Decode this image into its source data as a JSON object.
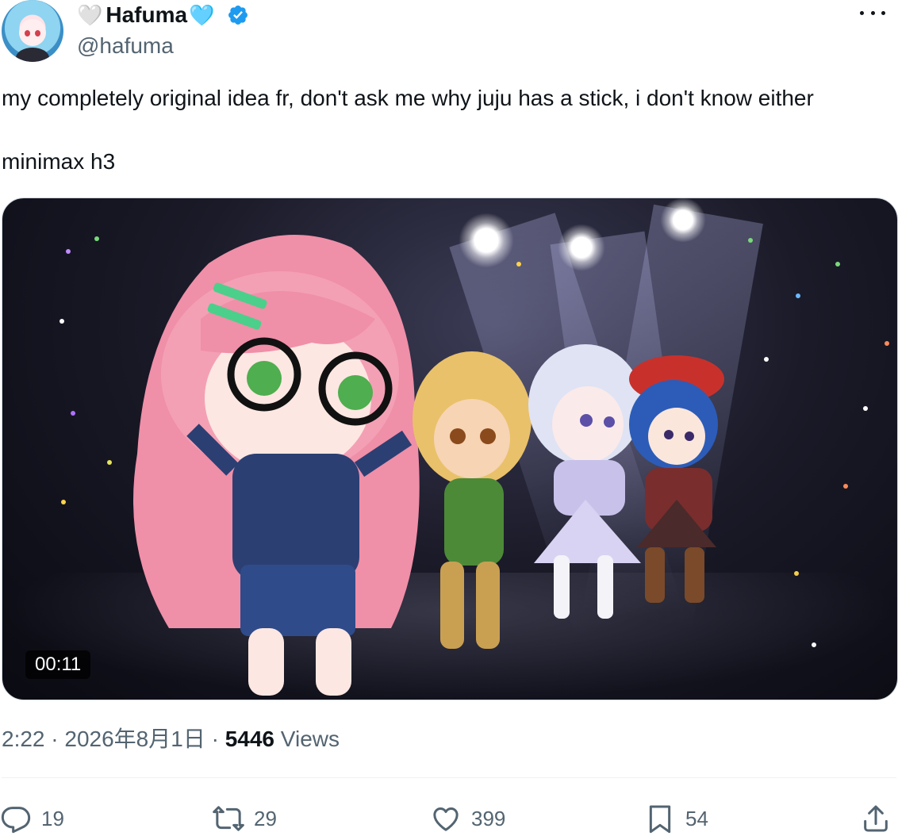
{
  "author": {
    "emoji_before": "🤍",
    "display_name": "Hafuma",
    "emoji_after": "🩵",
    "handle": "@hafuma",
    "verified": true
  },
  "tweet": {
    "line1": "my completely original idea fr, don't ask me why juju has a stick, i don't know either",
    "line2": "minimax h3"
  },
  "media": {
    "type": "video",
    "duration": "00:11"
  },
  "meta": {
    "time": "2:22",
    "separator1": "·",
    "date": "2026年8月1日",
    "separator2": "·",
    "views_count": "5446",
    "views_label": "Views"
  },
  "actions": {
    "replies": "19",
    "reposts": "29",
    "likes": "399",
    "bookmarks": "54"
  },
  "colors": {
    "text": "#0f1419",
    "secondary": "#536471",
    "verified": "#1d9bf0",
    "border": "#cfd9de"
  },
  "icons": {
    "more": "more-horizontal-icon",
    "verified": "verified-badge-icon",
    "reply": "reply-icon",
    "repost": "repost-icon",
    "like": "heart-icon",
    "bookmark": "bookmark-icon",
    "share": "share-icon"
  }
}
